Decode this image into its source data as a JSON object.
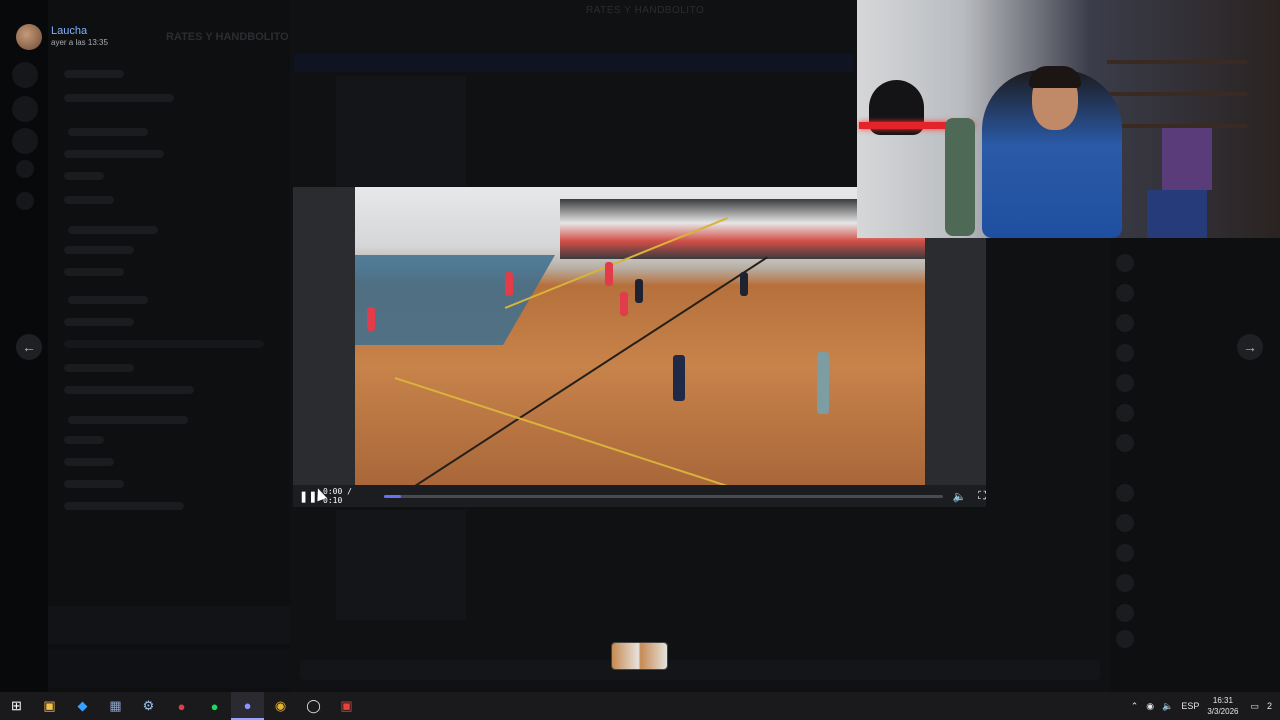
{
  "author": {
    "name": "Laucha",
    "time": "ayer a las 13:35"
  },
  "background": {
    "channel_header": "RATES Y HANDBOLITO",
    "server_title": "RATES Y HANDBOLITO"
  },
  "nav": {
    "prev_icon": "arrow-left-icon",
    "next_icon": "arrow-right-icon"
  },
  "video": {
    "time": "0:00 / 0:10",
    "progress": 0.03,
    "icons": [
      "pause-icon",
      "volume-icon",
      "fullscreen-icon"
    ]
  },
  "taskbar": {
    "apps": [
      "windows-start",
      "file-explorer",
      "app-blue",
      "app-chart",
      "steam",
      "app-red",
      "spotify",
      "discord",
      "chrome",
      "obs",
      "app-meta"
    ],
    "language": "ESP",
    "time": "16:31",
    "date": "3/3/2026",
    "notifications": "2"
  },
  "colors": {
    "accent": "#6b6ff2",
    "author": "#7fb2ff"
  }
}
